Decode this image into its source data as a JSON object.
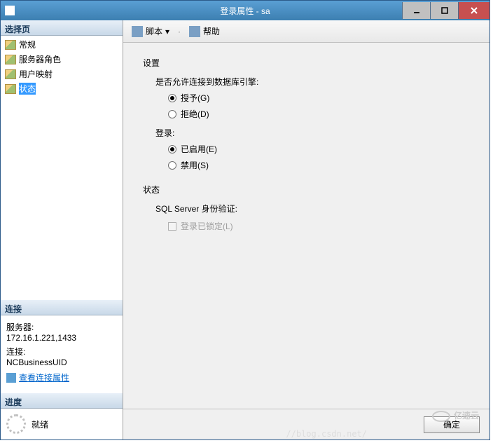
{
  "titlebar": {
    "title": "登录属性 - sa"
  },
  "sidebar": {
    "select_page": "选择页",
    "items": [
      {
        "label": "常规"
      },
      {
        "label": "服务器角色"
      },
      {
        "label": "用户映射"
      },
      {
        "label": "状态"
      }
    ],
    "connection_header": "连接",
    "server_label": "服务器:",
    "server_value": "172.16.1.221,1433",
    "conn_label": "连接:",
    "conn_value": "NCBusinessUID",
    "view_props": "查看连接属性",
    "progress_header": "进度",
    "ready": "就绪"
  },
  "toolbar": {
    "script": "脚本",
    "help": "帮助"
  },
  "content": {
    "settings": "设置",
    "allow_label": "是否允许连接到数据库引擎:",
    "grant": "授予(G)",
    "deny": "拒绝(D)",
    "login_label": "登录:",
    "enabled": "已启用(E)",
    "disabled": "禁用(S)",
    "status": "状态",
    "sql_auth": "SQL Server 身份验证:",
    "locked": "登录已锁定(L)"
  },
  "footer": {
    "ok": "确定"
  },
  "watermark": {
    "brand": "亿速云",
    "url": "//blog.csdn.net/"
  }
}
